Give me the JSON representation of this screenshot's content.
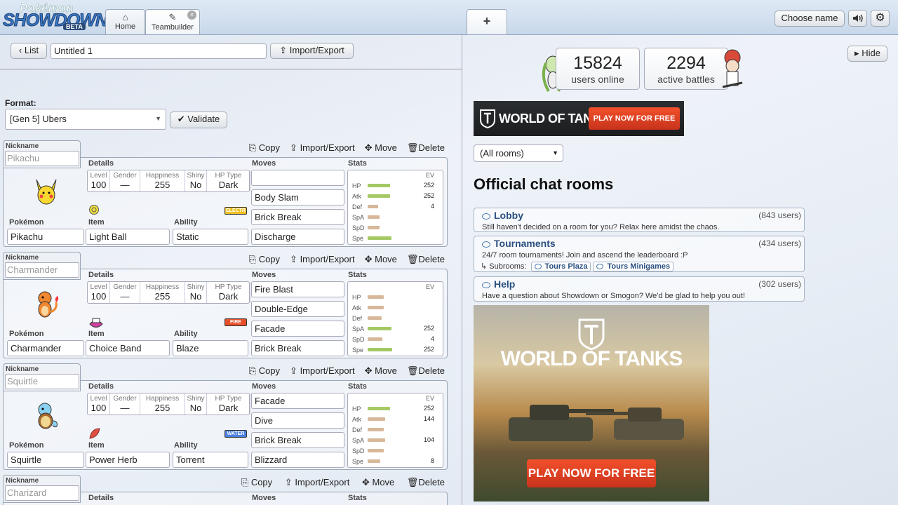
{
  "header": {
    "logo_top": "Pokémon",
    "logo_main": "SHOWDOWN",
    "logo_badge": "BETA",
    "tabs": [
      {
        "label": "Home"
      },
      {
        "label": "Teambuilder"
      }
    ],
    "new_tab": "+",
    "choose_name": "Choose name"
  },
  "toolbar": {
    "list_label": "List",
    "team_name": "Untitled 1",
    "import_export": "Import/Export",
    "format_label": "Format:",
    "format_value": "[Gen 5] Ubers",
    "validate": "Validate"
  },
  "labels": {
    "nickname": "Nickname",
    "details": "Details",
    "moves": "Moves",
    "stats": "Stats",
    "pokemon": "Pokémon",
    "item": "Item",
    "ability": "Ability",
    "level": "Level",
    "gender": "Gender",
    "happiness": "Happiness",
    "shiny": "Shiny",
    "hptype": "HP Type",
    "ev": "EV",
    "copy": "Copy",
    "import_export": "Import/Export",
    "move": "Move",
    "delete": "Delete",
    "stat_names": [
      "HP",
      "Atk",
      "Def",
      "SpA",
      "SpD",
      "Spe"
    ]
  },
  "sets": [
    {
      "nickname_placeholder": "Pikachu",
      "level": "100",
      "gender": "—",
      "happiness": "255",
      "shiny": "No",
      "hptype": "Dark",
      "moves": [
        "",
        "Body Slam",
        "Brick Break",
        "Discharge"
      ],
      "pokemon": "Pikachu",
      "item": "Light Ball",
      "ability": "Static",
      "type": "ELECTR",
      "type_color": "#f0c020",
      "evs": [
        "252",
        "252",
        "4",
        "",
        "",
        ""
      ],
      "bars": [
        0.58,
        0.58,
        0.28,
        0.3,
        0.3,
        0.62
      ]
    },
    {
      "nickname_placeholder": "Charmander",
      "level": "100",
      "gender": "—",
      "happiness": "255",
      "shiny": "No",
      "hptype": "Dark",
      "moves": [
        "Fire Blast",
        "Double-Edge",
        "Facade",
        "Brick Break"
      ],
      "pokemon": "Charmander",
      "item": "Choice Band",
      "ability": "Blaze",
      "type": "FIRE",
      "type_color": "#e8502a",
      "evs": [
        "",
        "",
        "",
        "252",
        "4",
        "252"
      ],
      "bars": [
        0.42,
        0.42,
        0.36,
        0.62,
        0.38,
        0.64
      ]
    },
    {
      "nickname_placeholder": "Squirtle",
      "level": "100",
      "gender": "—",
      "happiness": "255",
      "shiny": "No",
      "hptype": "Dark",
      "moves": [
        "Facade",
        "Dive",
        "Brick Break",
        "Blizzard"
      ],
      "pokemon": "Squirtle",
      "item": "Power Herb",
      "ability": "Torrent",
      "type": "WATER",
      "type_color": "#4a80e0",
      "evs": [
        "252",
        "144",
        "",
        "104",
        "",
        "8"
      ],
      "bars": [
        0.58,
        0.45,
        0.42,
        0.46,
        0.42,
        0.32
      ]
    }
  ],
  "partial_set": {
    "nickname_placeholder": "Charizard"
  },
  "right": {
    "hide": "Hide",
    "users_count": "15824",
    "users_label": "users online",
    "battles_count": "2294",
    "battles_label": "active battles",
    "ad_small_brand": "WORLD OF TANKS",
    "ad_small_cta": "PLAY NOW FOR FREE",
    "rooms_filter": "(All rooms)",
    "rooms_heading": "Official chat rooms",
    "rooms": [
      {
        "name": "Lobby",
        "users": "(843 users)",
        "desc": "Still haven't decided on a room for you? Relax here amidst the chaos."
      },
      {
        "name": "Tournaments",
        "users": "(434 users)",
        "desc": "24/7 room tournaments! Join and ascend the leaderboard :P"
      },
      {
        "name": "Help",
        "users": "(302 users)",
        "desc": "Have a question about Showdown or Smogon? We'd be glad to help you out!"
      }
    ],
    "subrooms_label": "Subrooms:",
    "subrooms": [
      "Tours Plaza",
      "Tours Minigames"
    ],
    "ad_big_brand": "WORLD OF TANKS",
    "ad_big_cta": "PLAY NOW FOR FREE"
  }
}
